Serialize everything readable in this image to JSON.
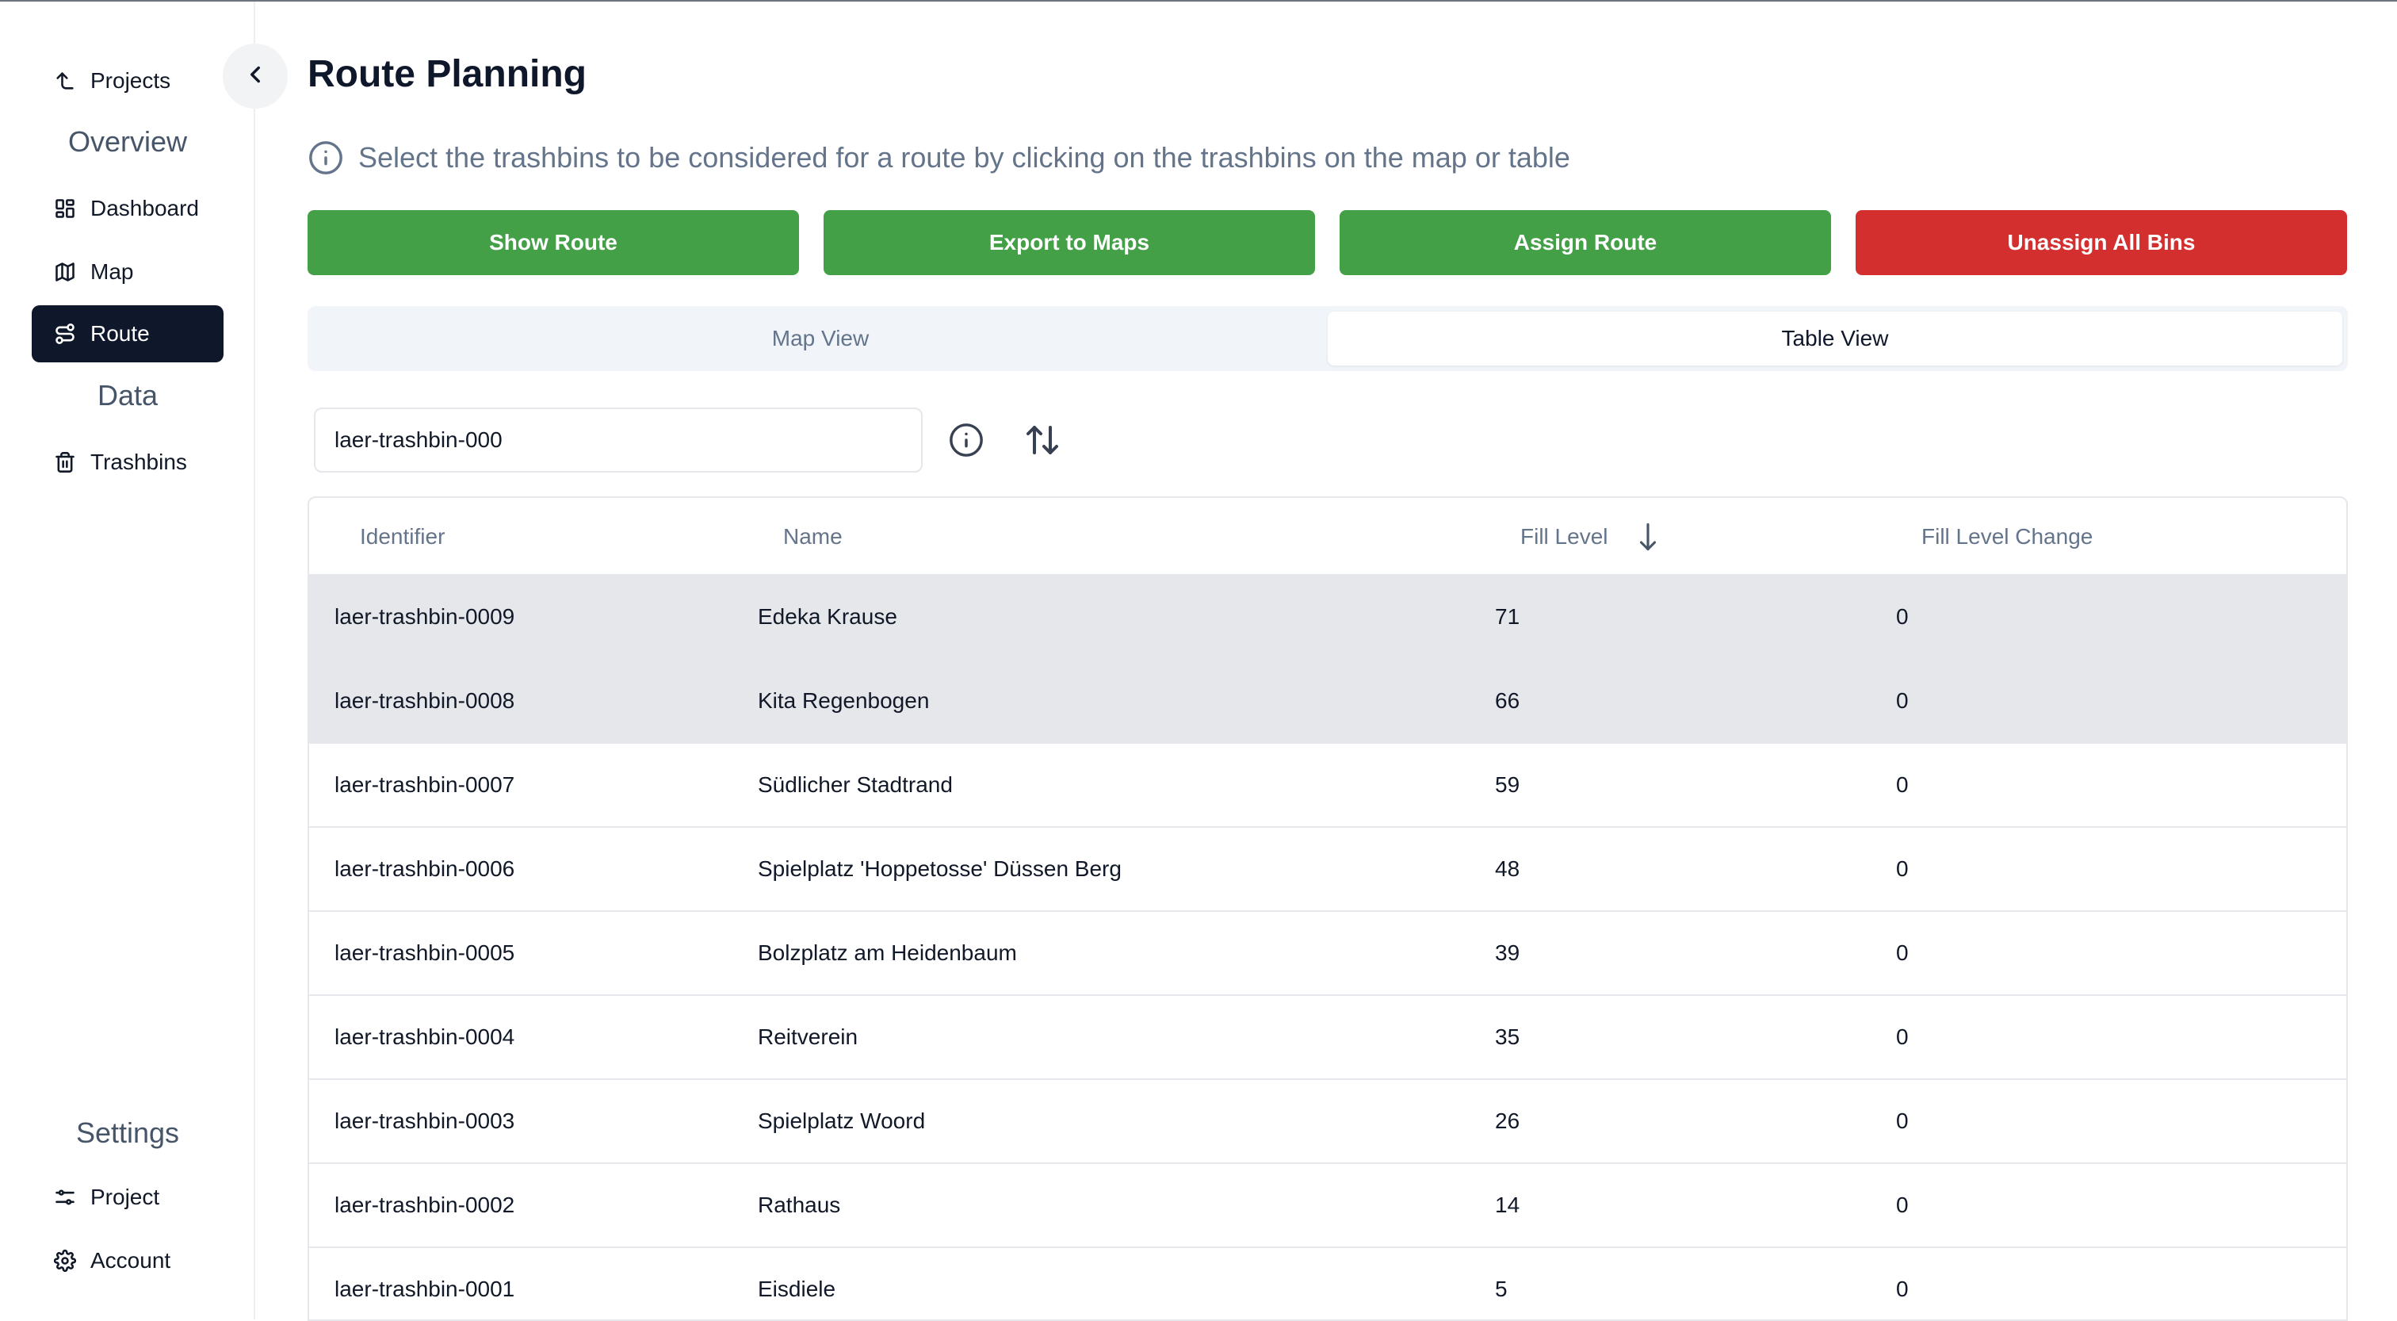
{
  "sidebar": {
    "back_link": "Projects",
    "sections": {
      "overview": "Overview",
      "data": "Data",
      "settings": "Settings"
    },
    "items": {
      "dashboard": "Dashboard",
      "map": "Map",
      "route": "Route",
      "trashbins": "Trashbins",
      "project": "Project",
      "account": "Account"
    }
  },
  "page": {
    "title": "Route Planning",
    "hint": "Select the trashbins to be considered for a route by clicking on the trashbins on the map or table"
  },
  "actions": {
    "show_route": "Show Route",
    "export_maps": "Export to Maps",
    "assign_route": "Assign Route",
    "unassign_all": "Unassign All Bins"
  },
  "tabs": {
    "map_view": "Map View",
    "table_view": "Table View",
    "active": "Table View"
  },
  "search": {
    "value": "laer-trashbin-000"
  },
  "table": {
    "headers": {
      "identifier": "Identifier",
      "name": "Name",
      "fill_level": "Fill Level",
      "fill_level_change": "Fill Level Change"
    },
    "sort": {
      "column": "Fill Level",
      "direction": "descending"
    },
    "rows": [
      {
        "id": "laer-trashbin-0009",
        "name": "Edeka Krause",
        "fill": "71",
        "change": "0",
        "selected": true
      },
      {
        "id": "laer-trashbin-0008",
        "name": "Kita Regenbogen",
        "fill": "66",
        "change": "0",
        "selected": true
      },
      {
        "id": "laer-trashbin-0007",
        "name": "Südlicher Stadtrand",
        "fill": "59",
        "change": "0",
        "selected": false
      },
      {
        "id": "laer-trashbin-0006",
        "name": "Spielplatz 'Hoppetosse' Düssen Berg",
        "fill": "48",
        "change": "0",
        "selected": false
      },
      {
        "id": "laer-trashbin-0005",
        "name": "Bolzplatz am Heidenbaum",
        "fill": "39",
        "change": "0",
        "selected": false
      },
      {
        "id": "laer-trashbin-0004",
        "name": "Reitverein",
        "fill": "35",
        "change": "0",
        "selected": false
      },
      {
        "id": "laer-trashbin-0003",
        "name": "Spielplatz Woord",
        "fill": "26",
        "change": "0",
        "selected": false
      },
      {
        "id": "laer-trashbin-0002",
        "name": "Rathaus",
        "fill": "14",
        "change": "0",
        "selected": false
      },
      {
        "id": "laer-trashbin-0001",
        "name": "Eisdiele",
        "fill": "5",
        "change": "0",
        "selected": false
      }
    ]
  },
  "colors": {
    "primary_green": "#43a047",
    "danger_red": "#d32f2f",
    "active_nav": "#0f172a",
    "selected_row": "#e5e7eb"
  }
}
